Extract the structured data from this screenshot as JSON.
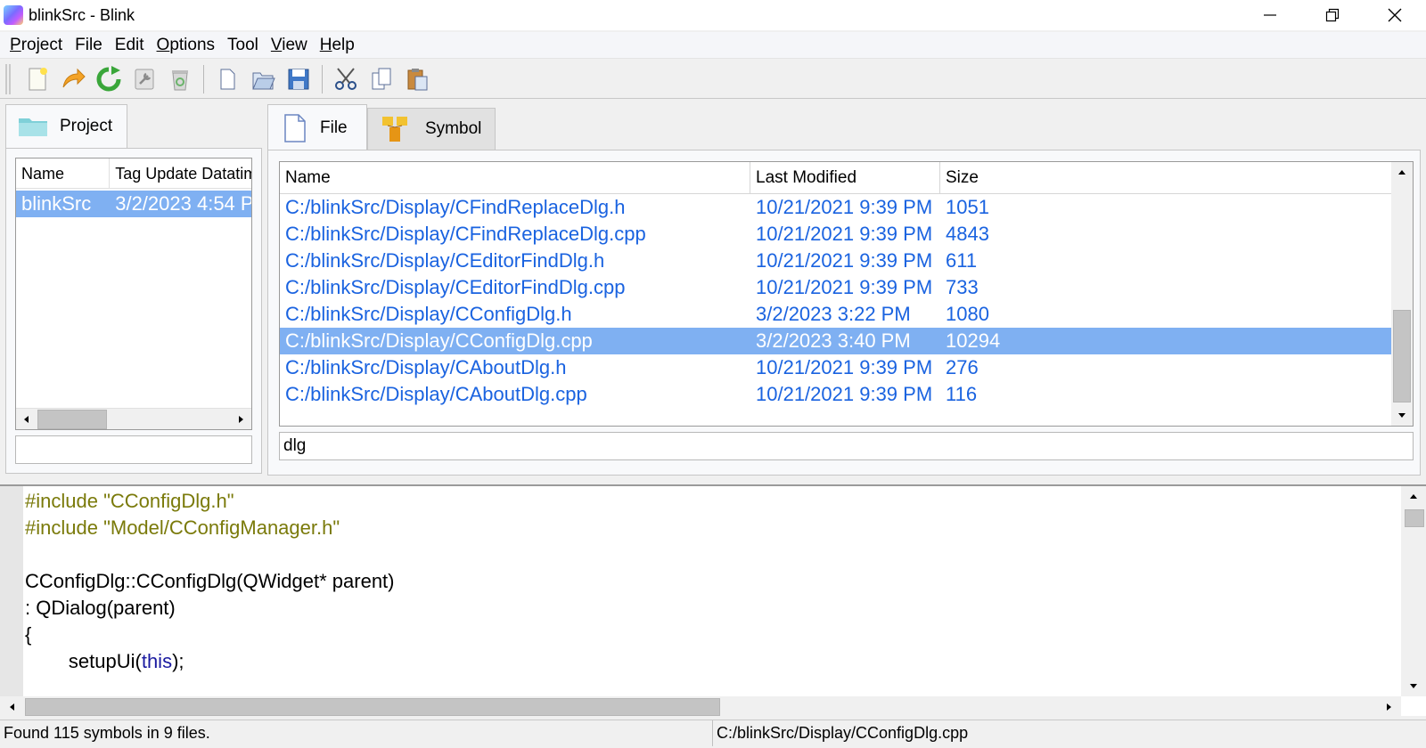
{
  "window": {
    "title": "blinkSrc - Blink",
    "controls": [
      "minimize-icon",
      "restore-icon",
      "close-icon"
    ]
  },
  "menu": [
    "Project",
    "File",
    "Edit",
    "Options",
    "Tool",
    "View",
    "Help"
  ],
  "toolbar": [
    "new-project-icon",
    "open-project-icon",
    "refresh-icon",
    "build-icon",
    "delete-icon",
    "new-file-icon",
    "open-file-icon",
    "save-icon",
    "cut-icon",
    "copy-icon",
    "paste-icon"
  ],
  "left_panel": {
    "tab_label": "Project",
    "columns": [
      "Name",
      "Tag Update Datatim"
    ],
    "rows": [
      {
        "name": "blinkSrc",
        "date": "3/2/2023 4:54 P"
      }
    ],
    "filter": ""
  },
  "right_panel": {
    "tabs": [
      {
        "label": "File",
        "active": true
      },
      {
        "label": "Symbol",
        "active": false
      }
    ],
    "columns": [
      "Name",
      "Last Modified",
      "Size"
    ],
    "rows": [
      {
        "name": "C:/blinkSrc/Display/CFindReplaceDlg.h",
        "modified": "10/21/2021 9:39 PM",
        "size": "1051"
      },
      {
        "name": "C:/blinkSrc/Display/CFindReplaceDlg.cpp",
        "modified": "10/21/2021 9:39 PM",
        "size": "4843"
      },
      {
        "name": "C:/blinkSrc/Display/CEditorFindDlg.h",
        "modified": "10/21/2021 9:39 PM",
        "size": "611"
      },
      {
        "name": "C:/blinkSrc/Display/CEditorFindDlg.cpp",
        "modified": "10/21/2021 9:39 PM",
        "size": "733"
      },
      {
        "name": "C:/blinkSrc/Display/CConfigDlg.h",
        "modified": "3/2/2023 3:22 PM",
        "size": "1080"
      },
      {
        "name": "C:/blinkSrc/Display/CConfigDlg.cpp",
        "modified": "3/2/2023 3:40 PM",
        "size": "10294",
        "selected": true
      },
      {
        "name": "C:/blinkSrc/Display/CAboutDlg.h",
        "modified": "10/21/2021 9:39 PM",
        "size": "276"
      },
      {
        "name": "C:/blinkSrc/Display/CAboutDlg.cpp",
        "modified": "10/21/2021 9:39 PM",
        "size": "116"
      }
    ],
    "filter": "dlg"
  },
  "editor": {
    "lines": [
      "#include \"CConfigDlg.h\"",
      "#include \"Model/CConfigManager.h\"",
      "",
      "CConfigDlg::CConfigDlg(QWidget* parent)",
      ": QDialog(parent)",
      "{",
      "        setupUi(this);"
    ]
  },
  "status": {
    "left": "Found 115 symbols in 9 files.",
    "right": "C:/blinkSrc/Display/CConfigDlg.cpp"
  },
  "colors": {
    "selection": "#7fb0f2",
    "link_text": "#1a63e0",
    "preprocessor": "#7a7a0a",
    "keyword": "#1a1aa0"
  }
}
